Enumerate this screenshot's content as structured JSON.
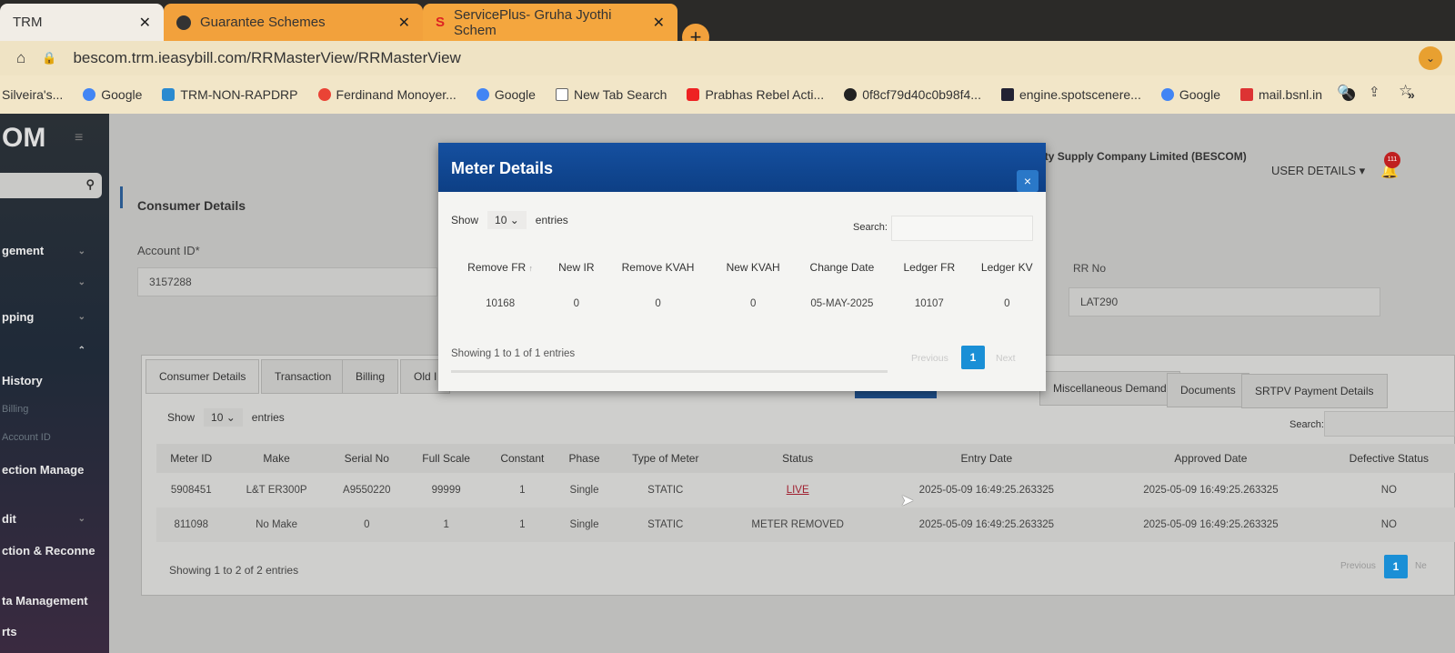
{
  "browser": {
    "tabs": [
      {
        "label": "TRM"
      },
      {
        "label": "Guarantee Schemes"
      },
      {
        "label": "ServicePlus- Gruha Jyothi Schem"
      }
    ],
    "new_tab": "+",
    "url": "bescom.trm.ieasybill.com/RRMasterView/RRMasterView",
    "bookmarks": [
      "Silveira's...",
      "Google",
      "TRM-NON-RAPDRP",
      "Ferdinand Monoyer...",
      "Google",
      "New Tab Search",
      "Prabhas Rebel Acti...",
      "0f8cf79d40c0b98f4...",
      "engine.spotscenere...",
      "Google",
      "mail.bsnl.in"
    ],
    "more": "»"
  },
  "app": {
    "logo": "OM",
    "company": "Bangalore Electricity Supply Company Limited (BESCOM)",
    "user_details": "USER DETAILS",
    "notification_count": "111",
    "sidebar": [
      "gement",
      "",
      "pping",
      "",
      "History",
      "Billing",
      "Account ID",
      "ection Manage",
      "dit",
      "ction & Reconne",
      "ta Management",
      "rts"
    ],
    "section_title": "Consumer Details",
    "account_id_label": "Account ID*",
    "account_id": "3157288",
    "rr_label": "RR No",
    "rr_no": "LAT290",
    "tabs": [
      "Consumer Details",
      "Transaction",
      "Billing",
      "Old I",
      "Miscellaneous Demand",
      "Documents",
      "SRTPV Payment Details"
    ],
    "show": "Show",
    "entries_select": "10",
    "entries": "entries",
    "search": "Search:",
    "columns": [
      "Meter ID",
      "Make",
      "Serial No",
      "Full Scale",
      "Constant",
      "Phase",
      "Type of Meter",
      "Status",
      "Entry Date",
      "Approved Date",
      "Defective Status"
    ],
    "rows": [
      [
        "5908451",
        "L&T ER300P",
        "A9550220",
        "99999",
        "1",
        "Single",
        "STATIC",
        "LIVE",
        "2025-05-09 16:49:25.263325",
        "2025-05-09 16:49:25.263325",
        "NO"
      ],
      [
        "811098",
        "No Make",
        "0",
        "1",
        "1",
        "Single",
        "STATIC",
        "METER REMOVED",
        "2025-05-09 16:49:25.263325",
        "2025-05-09 16:49:25.263325",
        "NO"
      ]
    ],
    "info": "Showing 1 to 2 of 2 entries",
    "prev": "Previous",
    "page": "1",
    "next": "Ne"
  },
  "modal": {
    "title": "Meter Details",
    "close": "×",
    "show": "Show",
    "entries_select": "10",
    "entries": "entries",
    "search": "Search:",
    "columns": [
      "Remove FR",
      "New IR",
      "Remove KVAH",
      "New KVAH",
      "Change Date",
      "Ledger FR",
      "Ledger KV"
    ],
    "row": [
      "10168",
      "0",
      "0",
      "0",
      "05-MAY-2025",
      "10107",
      "0"
    ],
    "info": "Showing 1 to 1 of 1 entries",
    "prev": "Previous",
    "page": "1",
    "next": "Next"
  }
}
